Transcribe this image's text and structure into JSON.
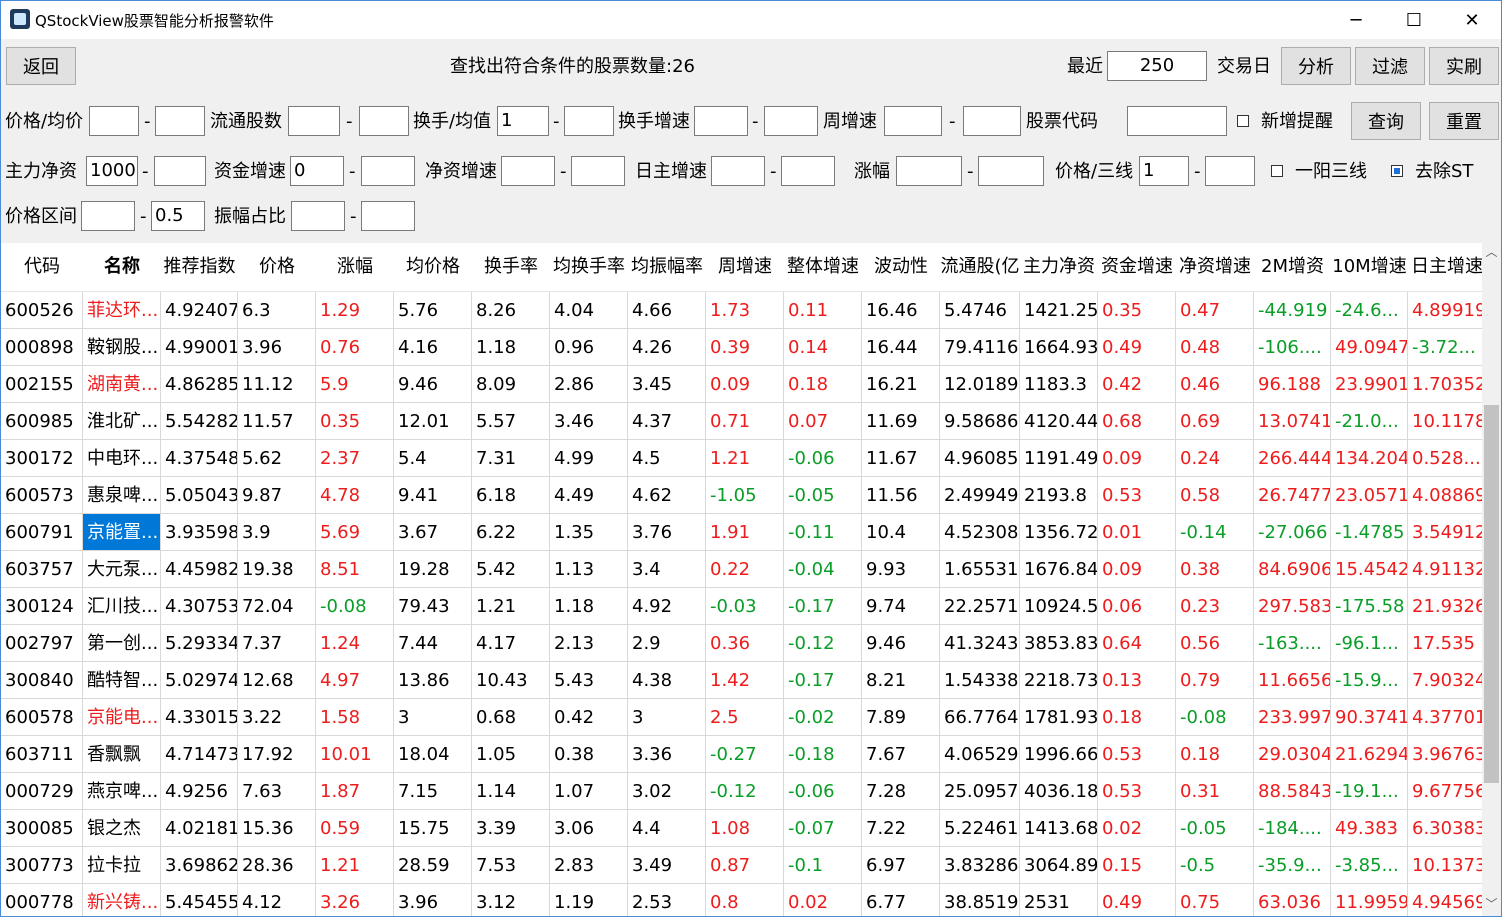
{
  "window": {
    "title": "QStockView股票智能分析报警软件",
    "minimize": "─",
    "maximize": "☐",
    "close": "✕"
  },
  "toolbar": {
    "back": "返回",
    "result_text": "查找出符合条件的股票数量:26",
    "recent_label": "最近",
    "recent_value": "250",
    "trade_day_label": "交易日",
    "analyze": "分析",
    "filter": "过滤",
    "refresh": "实刷"
  },
  "filters": {
    "price_avg": "价格/均价",
    "float_shares": "流通股数",
    "turnover_avg": "换手/均值",
    "turnover_avg_min": "1",
    "turnover_growth": "换手增速",
    "weekly_growth": "周增速",
    "stock_code": "股票代码",
    "new_alert": "新增提醒",
    "query": "查询",
    "reset": "重置",
    "main_net": "主力净资",
    "main_net_min": "1000",
    "fund_growth": "资金增速",
    "fund_growth_min": "0",
    "net_growth": "净资增速",
    "daily_main_growth": "日主增速",
    "change": "涨幅",
    "price_3line": "价格/三线",
    "price_3line_min": "1",
    "one_yang": "一阳三线",
    "remove_st": "去除ST",
    "price_range": "价格区间",
    "price_range_max": "0.5",
    "amplitude_ratio": "振幅占比",
    "dash": "-"
  },
  "table": {
    "headers": [
      "代码",
      "名称",
      "推荐指数",
      "价格",
      "涨幅",
      "均价格",
      "换手率",
      "均换手率",
      "均振幅率",
      "周增速",
      "整体增速",
      "波动性",
      "流通股(亿",
      "主力净资",
      "资金增速",
      "净资增速",
      "2M增资",
      "10M增速",
      "日主增速"
    ],
    "rows": [
      [
        "600526",
        "菲达环...",
        "4.92407",
        "6.3",
        "1.29",
        "5.76",
        "8.26",
        "4.04",
        "4.66",
        "1.73",
        "0.11",
        "16.46",
        "5.4746",
        "1421.25",
        "0.35",
        "0.47",
        "-44.919",
        "-24.6...",
        "4.89919"
      ],
      [
        "000898",
        "鞍钢股...",
        "4.99001",
        "3.96",
        "0.76",
        "4.16",
        "1.18",
        "0.96",
        "4.26",
        "0.39",
        "0.14",
        "16.44",
        "79.4116",
        "1664.93",
        "0.49",
        "0.48",
        "-106....",
        "49.0947",
        "-3.72..."
      ],
      [
        "002155",
        "湖南黄...",
        "4.86285",
        "11.12",
        "5.9",
        "9.46",
        "8.09",
        "2.86",
        "3.45",
        "0.09",
        "0.18",
        "16.21",
        "12.0189",
        "1183.3",
        "0.42",
        "0.46",
        "96.188",
        "23.9901",
        "1.70352"
      ],
      [
        "600985",
        "淮北矿...",
        "5.54282",
        "11.57",
        "0.35",
        "12.01",
        "5.57",
        "3.46",
        "4.37",
        "0.71",
        "0.07",
        "11.69",
        "9.58686",
        "4120.44",
        "0.68",
        "0.69",
        "13.0741",
        "-21.0...",
        "10.1178"
      ],
      [
        "300172",
        "中电环...",
        "4.37548",
        "5.62",
        "2.37",
        "5.4",
        "7.31",
        "4.99",
        "4.5",
        "1.21",
        "-0.06",
        "11.67",
        "4.96085",
        "1191.49",
        "0.09",
        "0.24",
        "266.444",
        "134.204",
        "0.528..."
      ],
      [
        "600573",
        "惠泉啤...",
        "5.05043",
        "9.87",
        "4.78",
        "9.41",
        "6.18",
        "4.49",
        "4.62",
        "-1.05",
        "-0.05",
        "11.56",
        "2.49949",
        "2193.8",
        "0.53",
        "0.58",
        "26.7477",
        "23.0571",
        "4.08869"
      ],
      [
        "600791",
        "京能置...",
        "3.93598",
        "3.9",
        "5.69",
        "3.67",
        "6.22",
        "1.35",
        "3.76",
        "1.91",
        "-0.11",
        "10.4",
        "4.52308",
        "1356.72",
        "0.01",
        "-0.14",
        "-27.066",
        "-1.4785",
        "3.54912"
      ],
      [
        "603757",
        "大元泵...",
        "4.45982",
        "19.38",
        "8.51",
        "19.28",
        "5.42",
        "1.13",
        "3.4",
        "0.22",
        "-0.04",
        "9.93",
        "1.65531",
        "1676.84",
        "0.09",
        "0.38",
        "84.6906",
        "15.4542",
        "4.91132"
      ],
      [
        "300124",
        "汇川技...",
        "4.30753",
        "72.04",
        "-0.08",
        "79.43",
        "1.21",
        "1.18",
        "4.92",
        "-0.03",
        "-0.17",
        "9.74",
        "22.2571",
        "10924.5",
        "0.06",
        "0.23",
        "297.583",
        "-175.58",
        "21.9326"
      ],
      [
        "002797",
        "第一创...",
        "5.29334",
        "7.37",
        "1.24",
        "7.44",
        "4.17",
        "2.13",
        "2.9",
        "0.36",
        "-0.12",
        "9.46",
        "41.3243",
        "3853.83",
        "0.64",
        "0.56",
        "-163....",
        "-96.1...",
        "17.535"
      ],
      [
        "300840",
        "酷特智...",
        "5.02974",
        "12.68",
        "4.97",
        "13.86",
        "10.43",
        "5.43",
        "4.38",
        "1.42",
        "-0.17",
        "8.21",
        "1.54338",
        "2218.73",
        "0.13",
        "0.79",
        "11.6656",
        "-15.9...",
        "7.90324"
      ],
      [
        "600578",
        "京能电...",
        "4.33015",
        "3.22",
        "1.58",
        "3",
        "0.68",
        "0.42",
        "3",
        "2.5",
        "-0.02",
        "7.89",
        "66.7764",
        "1781.93",
        "0.18",
        "-0.08",
        "233.997",
        "90.3741",
        "4.37701"
      ],
      [
        "603711",
        "香飘飘",
        "4.71473",
        "17.92",
        "10.01",
        "18.04",
        "1.05",
        "0.38",
        "3.36",
        "-0.27",
        "-0.18",
        "7.67",
        "4.06529",
        "1996.66",
        "0.53",
        "0.18",
        "29.0304",
        "21.6294",
        "3.96763"
      ],
      [
        "000729",
        "燕京啤...",
        "4.9256",
        "7.63",
        "1.87",
        "7.15",
        "1.14",
        "1.07",
        "3.02",
        "-0.12",
        "-0.06",
        "7.28",
        "25.0957",
        "4036.18",
        "0.53",
        "0.31",
        "88.5843",
        "-19.1...",
        "9.67756"
      ],
      [
        "300085",
        "银之杰",
        "4.02181",
        "15.36",
        "0.59",
        "15.75",
        "3.39",
        "3.06",
        "4.4",
        "1.08",
        "-0.07",
        "7.22",
        "5.22461",
        "1413.68",
        "0.02",
        "-0.05",
        "-184....",
        "49.383",
        "6.30383"
      ],
      [
        "300773",
        "拉卡拉",
        "3.69862",
        "28.36",
        "1.21",
        "28.59",
        "7.53",
        "2.83",
        "3.49",
        "0.87",
        "-0.1",
        "6.97",
        "3.83286",
        "3064.89",
        "0.15",
        "-0.5",
        "-35.9...",
        "-3.85...",
        "10.1373"
      ],
      [
        "000778",
        "新兴铸...",
        "5.45455",
        "4.12",
        "3.26",
        "3.96",
        "3.12",
        "1.19",
        "2.53",
        "0.8",
        "0.02",
        "6.77",
        "38.8519",
        "2531",
        "0.49",
        "0.75",
        "63.036",
        "11.9959",
        "4.94569"
      ]
    ],
    "red_names": [
      0,
      2,
      11,
      16
    ],
    "selected": {
      "row": 6,
      "col": 1
    },
    "colors": {
      "red": "#ee1c1c",
      "green": "#0a9e28",
      "selected": "#0078d7"
    }
  },
  "scrollbar": {
    "up": "︿",
    "down": "﹀"
  }
}
